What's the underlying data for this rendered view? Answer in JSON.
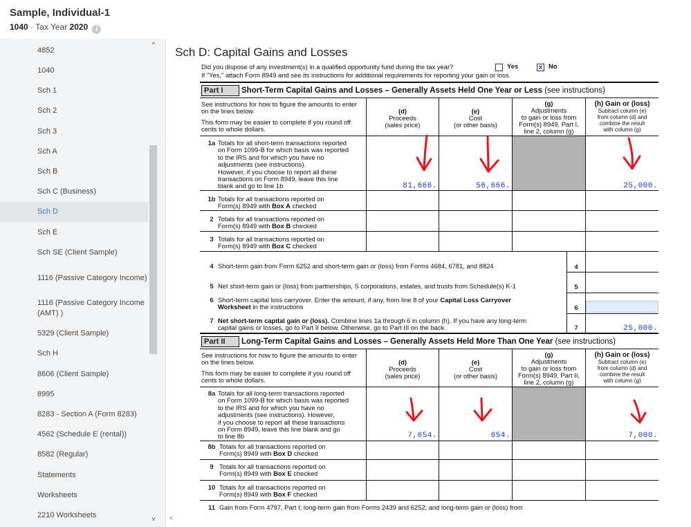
{
  "header": {
    "client_name": "Sample, Individual-1",
    "form": "1040",
    "separator": " · Tax Year ",
    "year": "2020",
    "info_icon": "i"
  },
  "sidebar": {
    "items": [
      {
        "label": "4852",
        "active": false
      },
      {
        "label": "1040",
        "active": false
      },
      {
        "label": "Sch 1",
        "active": false
      },
      {
        "label": "Sch 2",
        "active": false
      },
      {
        "label": "Sch 3",
        "active": false
      },
      {
        "label": "Sch A",
        "active": false
      },
      {
        "label": "Sch B",
        "active": false
      },
      {
        "label": "Sch C (Business)",
        "active": false
      },
      {
        "label": "Sch D",
        "active": true
      },
      {
        "label": "Sch E",
        "active": false
      },
      {
        "label": "Sch SE (Client Sample)",
        "active": false
      },
      {
        "label": "1116 (Passive Category Income)",
        "active": false
      },
      {
        "label": "1116 (Passive Category Income (AMT) )",
        "active": false
      },
      {
        "label": "5329 (Client Sample)",
        "active": false
      },
      {
        "label": "Sch H",
        "active": false
      },
      {
        "label": "8606 (Client Sample)",
        "active": false
      },
      {
        "label": "8995",
        "active": false
      },
      {
        "label": "8283 - Section A (Form 8283)",
        "active": false
      },
      {
        "label": "4562 (Schedule E (rental))",
        "active": false
      },
      {
        "label": "8582 (Regular)",
        "active": false
      },
      {
        "label": "Statements",
        "active": false
      },
      {
        "label": "Worksheets",
        "active": false
      },
      {
        "label": "2210 Worksheets",
        "active": false
      }
    ],
    "scroll_up": "^",
    "scroll_down": "v"
  },
  "form": {
    "title": "Sch D: Capital Gains and Losses",
    "qof_question": "Did you dispose of any investment(s) in a qualified opportunity fund during the tax year?",
    "qof_note": "If \"Yes,\" attach Form 8949 and see its instructions for additional requirements for reporting your gain or loss.",
    "yes_label": "Yes",
    "no_label": "No",
    "no_checked_mark": "x",
    "part1": {
      "label": "Part I",
      "title": "Short-Term Capital Gains and Losses",
      "title_rest": " – Generally Assets Held One Year or Less",
      "see": " (see instructions)",
      "instr1": "See instructions for how to figure the amounts to enter on the lines below.",
      "instr2": "This form may be easier to complete if you round off cents to whole dollars.",
      "col_d": [
        "(d)",
        "Proceeds",
        "(sales price)"
      ],
      "col_e": [
        "(e)",
        "Cost",
        "(or other basis)"
      ],
      "col_g": [
        "(g)",
        "Adjustments",
        "to gain or loss from",
        "Form(s) 8949, Part I,",
        "line 2, column (g)"
      ],
      "col_h": [
        "(h) Gain or (loss)",
        "Subtract column (e)",
        "from column (d) and",
        "combine the result",
        "with column (g)"
      ],
      "line1a_num": "1a",
      "line1a": [
        "Totals for all short-term transactions reported",
        "on Form 1099-B for which basis was reported",
        "to the IRS and for which you have no",
        "adjustments (see instructions).",
        "However, if you choose to report all these",
        "transactions on Form 8949, leave this line",
        "blank and go to line 1b"
      ],
      "line1a_d": "81,666.",
      "line1a_e": "56,666.",
      "line1a_h": "25,000.",
      "line1b_num": "1b",
      "line1b": [
        "Totals for all transactions reported on",
        "Form(s) 8949 with "
      ],
      "line1b_box": "Box A",
      "line2_num": "2",
      "line2": [
        "Totals for all transactions reported on",
        "Form(s) 8949 with "
      ],
      "line2_box": "Box B",
      "line3_num": "3",
      "line3": [
        "Totals for all transactions reported on",
        "Form(s) 8949 with "
      ],
      "line3_box": "Box C",
      "checked": "checked",
      "line4_num": "4",
      "line4": "Short-term gain from Form 6252 and short-term gain or (loss) from Forms 4684, 6781, and 8824",
      "line5_num": "5",
      "line5": "Net short-term gain or (loss) from partnerships, S corporations, estates, and trusts from Schedule(s) K-1",
      "line6_num": "6",
      "line6a": "Short-term capital loss carryover. Enter the amount, if any, from line 8 of your ",
      "line6b": "Capital Loss Carryover",
      "line6c": "Worksheet",
      "line6d": " in the instructions",
      "line7_num": "7",
      "line7a": "Net short-term capital gain or (loss).",
      "line7b": " Combine lines 1a through 6 in column (h). If you have any long-term",
      "line7c": "capital gains or losses, go to Part II below. Otherwise, go to Part III on the back",
      "line7_h": "25,000."
    },
    "part2": {
      "label": "Part II",
      "title": "Long-Term Capital Gains and Losses",
      "title_rest": " – Generally Assets Held More Than One Year",
      "see": " (see instructions)",
      "instr1": "See instructions for how to figure the amounts to enter on the lines below.",
      "instr2": "This form may be easier to complete if you round off cents to whole dollars.",
      "col_d": [
        "(d)",
        "Proceeds",
        "(sales price)"
      ],
      "col_e": [
        "(e)",
        "Cost",
        "(or other basis)"
      ],
      "col_g": [
        "(g)",
        "Adjustments",
        "to gain or loss from",
        "Form(s) 8949, Part II,",
        "line 2, column (g)"
      ],
      "col_h": [
        "(h) Gain or (loss)",
        "Subtract column (e)",
        "from column (d) and",
        "combine the result",
        "with column (g)"
      ],
      "line8a_num": "8a",
      "line8a": [
        "Totals for all long-term transactions reported",
        "on Form 1099-B for which basis was reported",
        "to the IRS and for which you have no",
        "adjustments (see instructions). However,",
        "if you choose to report all these transactions",
        "on Form 8949, leave this line blank and go",
        "to line 8b"
      ],
      "line8a_d": "7,654.",
      "line8a_e": "654.",
      "line8a_h": "7,000.",
      "line8b_num": "8b",
      "line8b": [
        "Totals for all transactions reported on",
        "Form(s) 8949 with "
      ],
      "line8b_box": "Box D",
      "line9_num": "9",
      "line9": [
        "Totals for all transactions reported on",
        "Form(s) 8949 with "
      ],
      "line9_box": "Box E",
      "line10_num": "10",
      "line10": [
        "Totals for all transactions reported on",
        "Form(s) 8949 with "
      ],
      "line10_box": "Box F",
      "checked": "checked",
      "line11_num": "11",
      "line11": "Gain from Form 4797, Part I; long-term gain from Forms 2439 and 6252; and long-term gain or (loss) from"
    },
    "annotation_color": "#e8141b"
  }
}
